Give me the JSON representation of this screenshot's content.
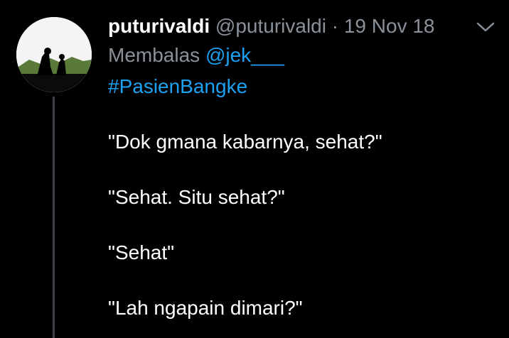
{
  "tweet": {
    "display_name": "puturivaldi",
    "handle": "@puturivaldi",
    "separator": "·",
    "date": "19 Nov 18",
    "reply_prefix": "Membalas",
    "reply_to": "@jek___",
    "hashtag": "#PasienBangke",
    "lines": [
      "\"Dok gmana kabarnya, sehat?\"",
      "\"Sehat. Situ sehat?\"",
      "\"Sehat\"",
      "\"Lah ngapain dimari?\""
    ]
  },
  "icons": {
    "menu": "chevron-down-icon"
  },
  "colors": {
    "background": "#000000",
    "text": "#ffffff",
    "muted": "#8a9198",
    "link": "#1da1f2",
    "thread_line": "#3d4148"
  }
}
